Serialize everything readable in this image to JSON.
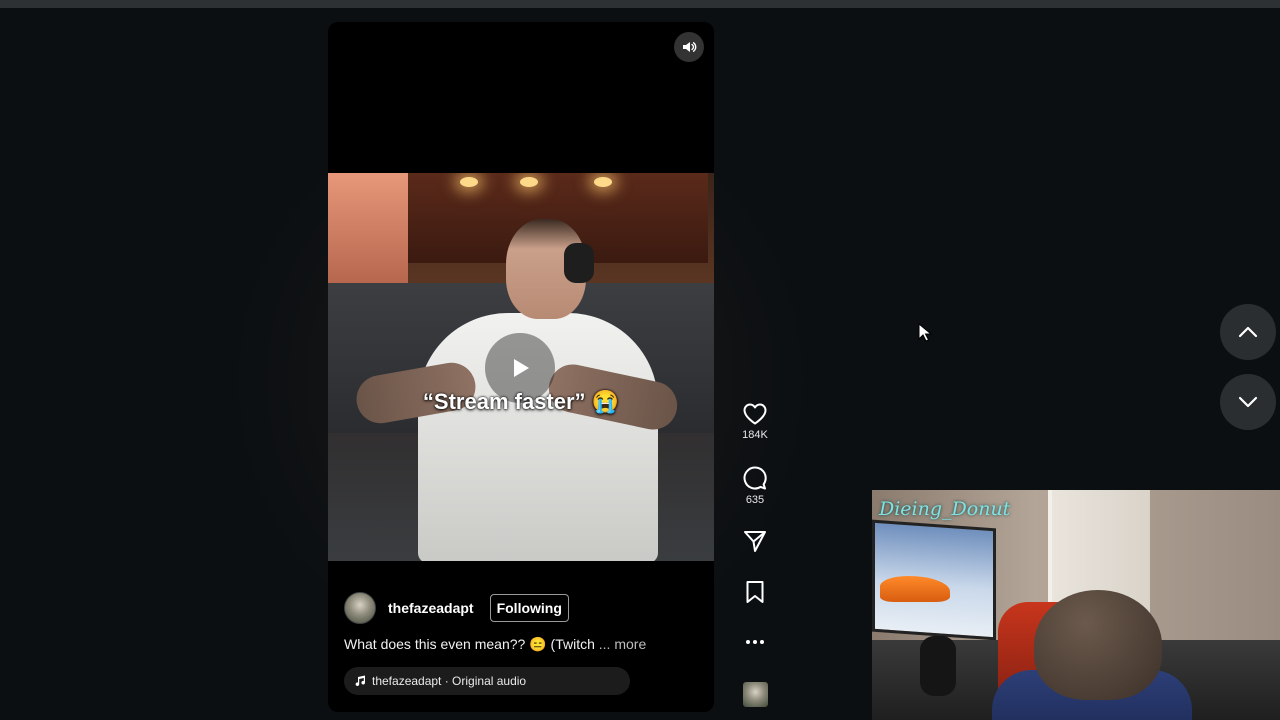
{
  "video": {
    "caption": "“Stream faster” 😭",
    "author": "thefazeadapt",
    "follow_label": "Following",
    "description": "What does this even mean?? 😑 (Twitch",
    "more_label": "... more",
    "audio_label": "thefazeadapt · Original audio"
  },
  "actions": {
    "like_count": "184K",
    "comment_count": "635"
  },
  "webcam": {
    "overlay_name": "Dieing_Donut"
  },
  "icons": {
    "mute": "volume-icon",
    "play": "play-icon",
    "like": "heart-icon",
    "comment": "comment-icon",
    "share": "share-icon",
    "save": "bookmark-icon",
    "more": "more-icon",
    "up": "chevron-up-icon",
    "down": "chevron-down-icon",
    "audio": "music-note-icon"
  },
  "colors": {
    "background": "#0b0f12",
    "nav_button": "#2a2e31",
    "webcam_name": "#7fe3e3"
  }
}
